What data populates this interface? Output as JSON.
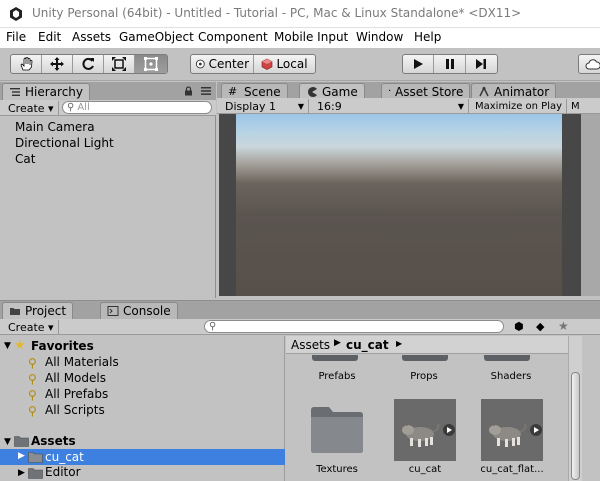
{
  "window": {
    "title": "Unity Personal (64bit) - Untitled - Tutorial - PC, Mac & Linux Standalone* <DX11>"
  },
  "menu": [
    "File",
    "Edit",
    "Assets",
    "GameObject",
    "Component",
    "Mobile Input",
    "Window",
    "Help"
  ],
  "toolbar": {
    "pivot_label": "Center",
    "space_label": "Local"
  },
  "hierarchy": {
    "tab_label": "Hierarchy",
    "create_label": "Create ▾",
    "search_placeholder": "All",
    "items": [
      "Main Camera",
      "Directional Light",
      "Cat"
    ]
  },
  "scene_tabs": {
    "scene_label": "Scene",
    "game_label": "Game",
    "asset_store_label": "Asset Store",
    "animator_label": "Animator"
  },
  "game_view": {
    "display_label": "Display 1",
    "aspect_label": "16:9",
    "maximize_label": "Maximize on Play",
    "m_label": "M"
  },
  "project": {
    "tab_label": "Project",
    "console_label": "Console",
    "create_label": "Create ▾",
    "favorites_label": "Favorites",
    "favorites": [
      "All Materials",
      "All Models",
      "All Prefabs",
      "All Scripts"
    ],
    "assets_label": "Assets",
    "asset_folders": [
      "cu_cat",
      "Editor"
    ],
    "selected_folder": "cu_cat",
    "breadcrumb": {
      "root": "Assets",
      "current": "cu_cat"
    },
    "tiles_top": [
      "Prefabs",
      "Props",
      "Shaders"
    ],
    "tiles_bottom": [
      "Textures",
      "cu_cat",
      "cu_cat_flat..."
    ]
  },
  "colors": {
    "selection": "#3d80df",
    "panel_bg": "#c2c2c2",
    "sky_top": "#9bc6e8",
    "ground": "#5b5550"
  }
}
